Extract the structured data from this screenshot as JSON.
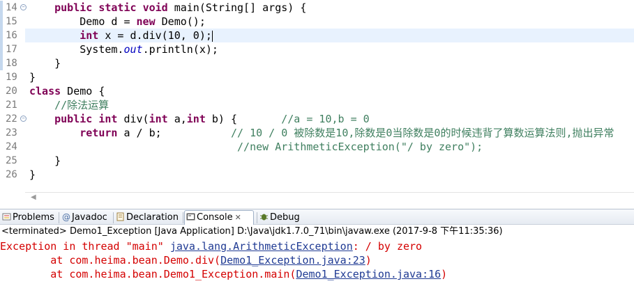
{
  "editor": {
    "line_numbers": [
      "14",
      "15",
      "16",
      "17",
      "18",
      "19",
      "20",
      "21",
      "22",
      "23",
      "24",
      "25",
      "26"
    ],
    "lines": [
      [
        {
          "t": "    "
        },
        {
          "t": "public",
          "c": "kw"
        },
        {
          "t": " "
        },
        {
          "t": "static",
          "c": "kw"
        },
        {
          "t": " "
        },
        {
          "t": "void",
          "c": "kw"
        },
        {
          "t": " main(String[] args) {"
        }
      ],
      [
        {
          "t": "        Demo d = "
        },
        {
          "t": "new",
          "c": "kw"
        },
        {
          "t": " Demo();"
        }
      ],
      [
        {
          "t": "        "
        },
        {
          "t": "int",
          "c": "kw"
        },
        {
          "t": " x = d.div(10, 0);"
        },
        {
          "caret": true
        }
      ],
      [
        {
          "t": "        System."
        },
        {
          "t": "out",
          "c": "static"
        },
        {
          "t": ".println(x);"
        }
      ],
      [
        {
          "t": "    }"
        }
      ],
      [
        {
          "t": "}"
        }
      ],
      [
        {
          "t": "class",
          "c": "kw"
        },
        {
          "t": " Demo {"
        }
      ],
      [
        {
          "t": "    "
        },
        {
          "t": "//除法运算",
          "c": "cmt"
        }
      ],
      [
        {
          "t": "    "
        },
        {
          "t": "public",
          "c": "kw"
        },
        {
          "t": " "
        },
        {
          "t": "int",
          "c": "kw"
        },
        {
          "t": " div("
        },
        {
          "t": "int",
          "c": "kw"
        },
        {
          "t": " a,"
        },
        {
          "t": "int",
          "c": "kw"
        },
        {
          "t": " b) {       "
        },
        {
          "t": "//a = 10,b = 0",
          "c": "cmt"
        }
      ],
      [
        {
          "t": "        "
        },
        {
          "t": "return",
          "c": "kw"
        },
        {
          "t": " a / b;           "
        },
        {
          "t": "// 10 / 0 被除数是10,除数是0当除数是0的时候违背了算数运算法则,抛出异常",
          "c": "cmt"
        }
      ],
      [
        {
          "t": "                                 "
        },
        {
          "t": "//new ArithmeticException(\"/ by zero\");",
          "c": "cmt"
        }
      ],
      [
        {
          "t": "    }"
        }
      ],
      [
        {
          "t": "}"
        }
      ]
    ],
    "fold_markers": {
      "0": "⊖",
      "8": "⊖"
    },
    "current_line_index": 2
  },
  "console": {
    "tabs": [
      {
        "label": "Problems",
        "icon": "problems-icon",
        "active": false
      },
      {
        "label": "Javadoc",
        "icon": "javadoc-icon",
        "active": false
      },
      {
        "label": "Declaration",
        "icon": "declaration-icon",
        "active": false
      },
      {
        "label": "Console",
        "icon": "console-icon",
        "active": true,
        "close": "✕"
      },
      {
        "label": "Debug",
        "icon": "debug-icon",
        "active": false
      }
    ],
    "status": "<terminated> Demo1_Exception [Java Application] D:\\Java\\jdk1.7.0_71\\bin\\javaw.exe (2017-9-8 下午11:35:36)",
    "output": [
      [
        {
          "t": "Exception in thread \"main\" "
        },
        {
          "t": "java.lang.ArithmeticException",
          "link": true
        },
        {
          "t": ": / by zero"
        }
      ],
      [
        {
          "t": "        at com.heima.bean.Demo.div("
        },
        {
          "t": "Demo1_Exception.java:23",
          "link": true
        },
        {
          "t": ")"
        }
      ],
      [
        {
          "t": "        at com.heima.bean.Demo1_Exception.main("
        },
        {
          "t": "Demo1_Exception.java:16",
          "link": true
        },
        {
          "t": ")"
        }
      ]
    ]
  },
  "colors": {
    "keyword": "#7f0055",
    "comment": "#3f7f5f",
    "error": "#d40000",
    "link": "#1f3a93"
  }
}
